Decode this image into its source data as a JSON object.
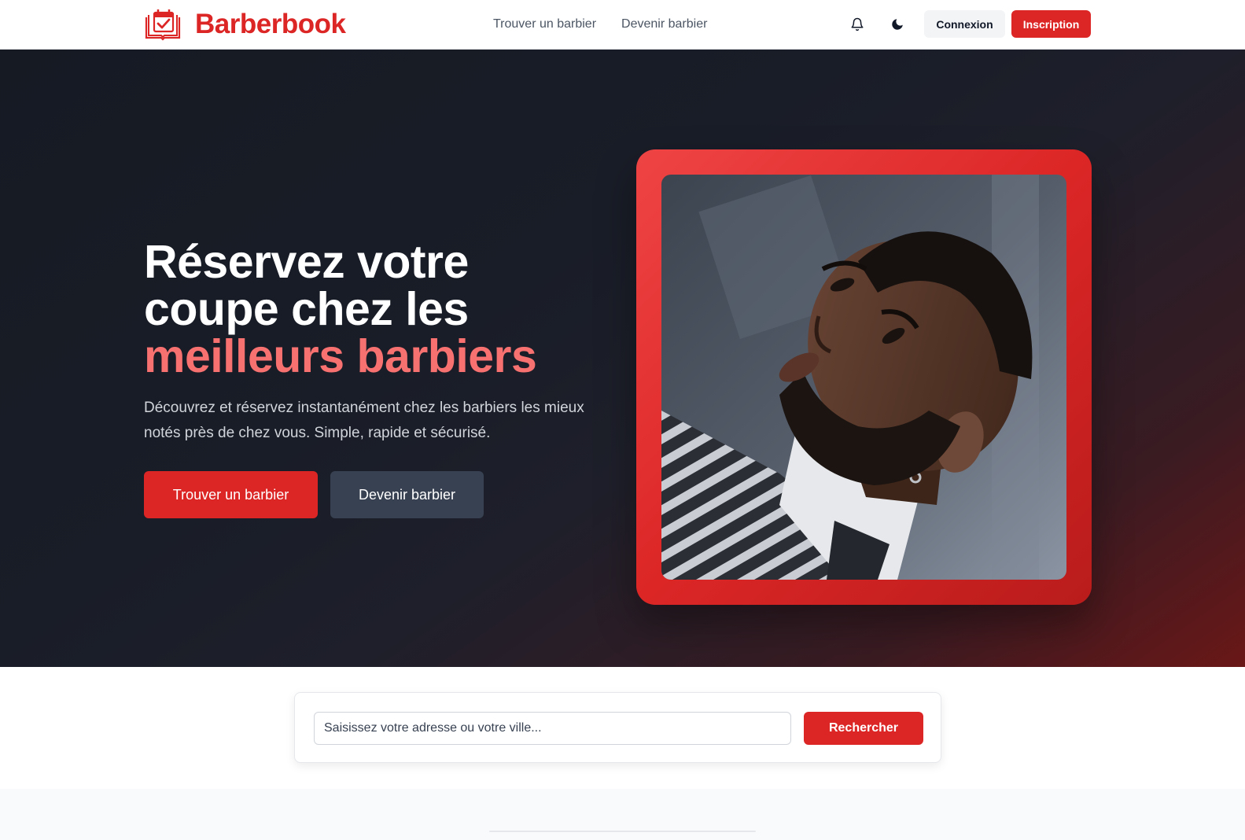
{
  "header": {
    "brand": "Barberbook",
    "nav": [
      {
        "label": "Trouver un barbier"
      },
      {
        "label": "Devenir barbier"
      }
    ],
    "icons": {
      "notifications": "bell-icon",
      "theme": "moon-icon"
    },
    "login_label": "Connexion",
    "signup_label": "Inscription"
  },
  "hero": {
    "title_line1": "Réservez votre",
    "title_line2": "coupe chez les",
    "title_accent": "meilleurs barbiers",
    "subtitle": "Découvrez et réservez instantanément chez les barbiers les mieux notés près de chez vous. Simple, rapide et sécurisé.",
    "primary_cta": "Trouver un barbier",
    "secondary_cta": "Devenir barbier"
  },
  "search": {
    "placeholder": "Saisissez votre adresse ou votre ville...",
    "value": "",
    "button_label": "Rechercher"
  },
  "colors": {
    "brand": "#dc2626",
    "accent_text": "#f87171",
    "hero_dark": "#161a23"
  }
}
